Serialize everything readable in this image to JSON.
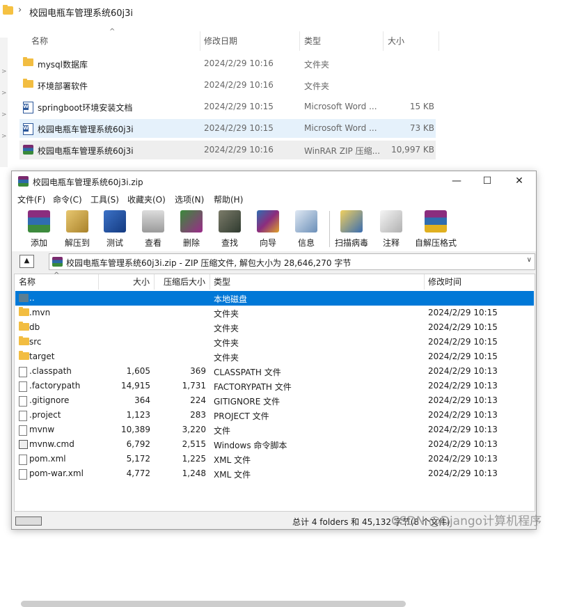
{
  "explorer": {
    "breadcrumb": "校园电瓶车管理系统60j3i",
    "columns": {
      "name": "名称",
      "date": "修改日期",
      "type": "类型",
      "size": "大小"
    },
    "rows": [
      {
        "icon": "folder-icon",
        "name": "mysql数据库",
        "date": "2024/2/29 10:16",
        "type": "文件夹",
        "size": ""
      },
      {
        "icon": "folder-icon",
        "name": "环境部署软件",
        "date": "2024/2/29 10:16",
        "type": "文件夹",
        "size": ""
      },
      {
        "icon": "word-icon",
        "name": "springboot环境安装文档",
        "date": "2024/2/29 10:15",
        "type": "Microsoft Word ...",
        "size": "15 KB"
      },
      {
        "icon": "word-icon",
        "name": "校园电瓶车管理系统60j3i",
        "date": "2024/2/29 10:15",
        "type": "Microsoft Word ...",
        "size": "73 KB"
      },
      {
        "icon": "winrar-icon",
        "name": "校园电瓶车管理系统60j3i",
        "date": "2024/2/29 10:16",
        "type": "WinRAR ZIP 压缩...",
        "size": "10,997 KB"
      }
    ]
  },
  "winrar": {
    "title": "校园电瓶车管理系统60j3i.zip",
    "menu": [
      "文件(F)",
      "命令(C)",
      "工具(S)",
      "收藏夹(O)",
      "选项(N)",
      "帮助(H)"
    ],
    "toolbar": [
      "添加",
      "解压到",
      "测试",
      "查看",
      "删除",
      "查找",
      "向导",
      "信息",
      "扫描病毒",
      "注释",
      "自解压格式"
    ],
    "address": "校园电瓶车管理系统60j3i.zip - ZIP 压缩文件, 解包大小为 28,646,270 字节",
    "columns": {
      "name": "名称",
      "size": "大小",
      "packed": "压缩后大小",
      "type": "类型",
      "modified": "修改时间"
    },
    "rows": [
      {
        "icon": "up-folder-icon",
        "name": "..",
        "size": "",
        "packed": "",
        "type": "本地磁盘",
        "modified": ""
      },
      {
        "icon": "folder-icon",
        "name": ".mvn",
        "size": "",
        "packed": "",
        "type": "文件夹",
        "modified": "2024/2/29 10:15"
      },
      {
        "icon": "folder-icon",
        "name": "db",
        "size": "",
        "packed": "",
        "type": "文件夹",
        "modified": "2024/2/29 10:15"
      },
      {
        "icon": "folder-icon",
        "name": "src",
        "size": "",
        "packed": "",
        "type": "文件夹",
        "modified": "2024/2/29 10:15"
      },
      {
        "icon": "folder-icon",
        "name": "target",
        "size": "",
        "packed": "",
        "type": "文件夹",
        "modified": "2024/2/29 10:15"
      },
      {
        "icon": "file-icon",
        "name": ".classpath",
        "size": "1,605",
        "packed": "369",
        "type": "CLASSPATH 文件",
        "modified": "2024/2/29 10:13"
      },
      {
        "icon": "file-icon",
        "name": ".factorypath",
        "size": "14,915",
        "packed": "1,731",
        "type": "FACTORYPATH 文件",
        "modified": "2024/2/29 10:13"
      },
      {
        "icon": "file-icon",
        "name": ".gitignore",
        "size": "364",
        "packed": "224",
        "type": "GITIGNORE 文件",
        "modified": "2024/2/29 10:13"
      },
      {
        "icon": "file-icon",
        "name": ".project",
        "size": "1,123",
        "packed": "283",
        "type": "PROJECT 文件",
        "modified": "2024/2/29 10:13"
      },
      {
        "icon": "file-icon",
        "name": "mvnw",
        "size": "10,389",
        "packed": "3,220",
        "type": "文件",
        "modified": "2024/2/29 10:13"
      },
      {
        "icon": "cmd-icon",
        "name": "mvnw.cmd",
        "size": "6,792",
        "packed": "2,515",
        "type": "Windows 命令脚本",
        "modified": "2024/2/29 10:13"
      },
      {
        "icon": "file-icon",
        "name": "pom.xml",
        "size": "5,172",
        "packed": "1,225",
        "type": "XML 文件",
        "modified": "2024/2/29 10:13"
      },
      {
        "icon": "file-icon",
        "name": "pom-war.xml",
        "size": "4,772",
        "packed": "1,248",
        "type": "XML 文件",
        "modified": "2024/2/29 10:13"
      }
    ],
    "status": "总计 4 folders 和 45,132 字节(8 个文件)"
  },
  "watermark": "CSDN @Django计算机程序"
}
